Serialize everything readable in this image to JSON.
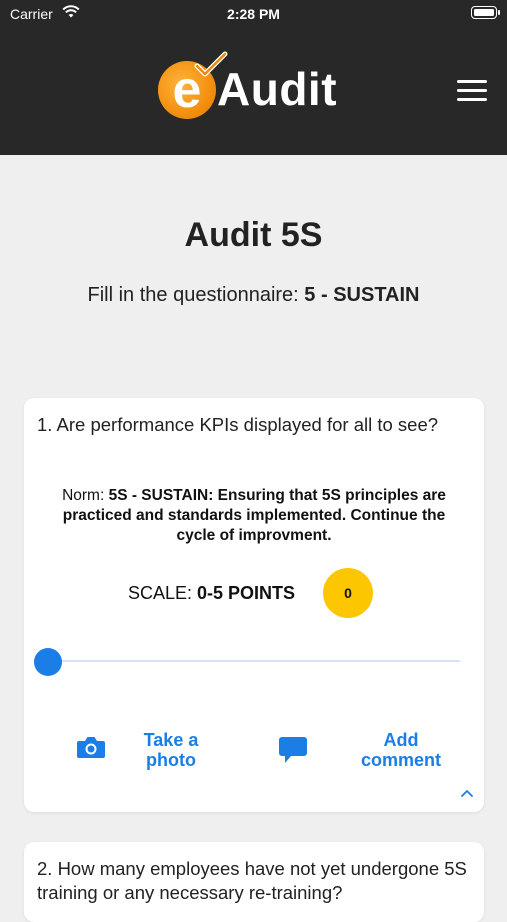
{
  "status_bar": {
    "carrier": "Carrier",
    "time": "2:28 PM"
  },
  "header": {
    "logo_e": "e",
    "logo_text": "Audit"
  },
  "page": {
    "title": "Audit 5S",
    "subtitle_prefix": "Fill in the questionnaire: ",
    "subtitle_value": "5 - SUSTAIN"
  },
  "questions": [
    {
      "text": "1. Are performance KPIs displayed for all to see?",
      "norm_prefix": "Norm: ",
      "norm_text": "5S - SUSTAIN: Ensuring that 5S principles are practiced and standards implemented. Continue the cycle of improvment.",
      "scale_prefix": "SCALE: ",
      "scale_value": "0-5 POINTS",
      "score": "0",
      "slider_value": 0,
      "take_photo_label": "Take a photo",
      "add_comment_label": "Add comment"
    },
    {
      "text": "2. How many employees have not yet undergone 5S training or any necessary re-training?"
    }
  ],
  "colors": {
    "header_bg": "#282828",
    "accent": "#1a7ee6",
    "badge": "#fcc600",
    "logo_orange": "#f08a0a"
  },
  "icons": [
    "wifi-icon",
    "battery-icon",
    "menu-icon",
    "camera-icon",
    "comment-icon",
    "chevron-up-icon"
  ]
}
